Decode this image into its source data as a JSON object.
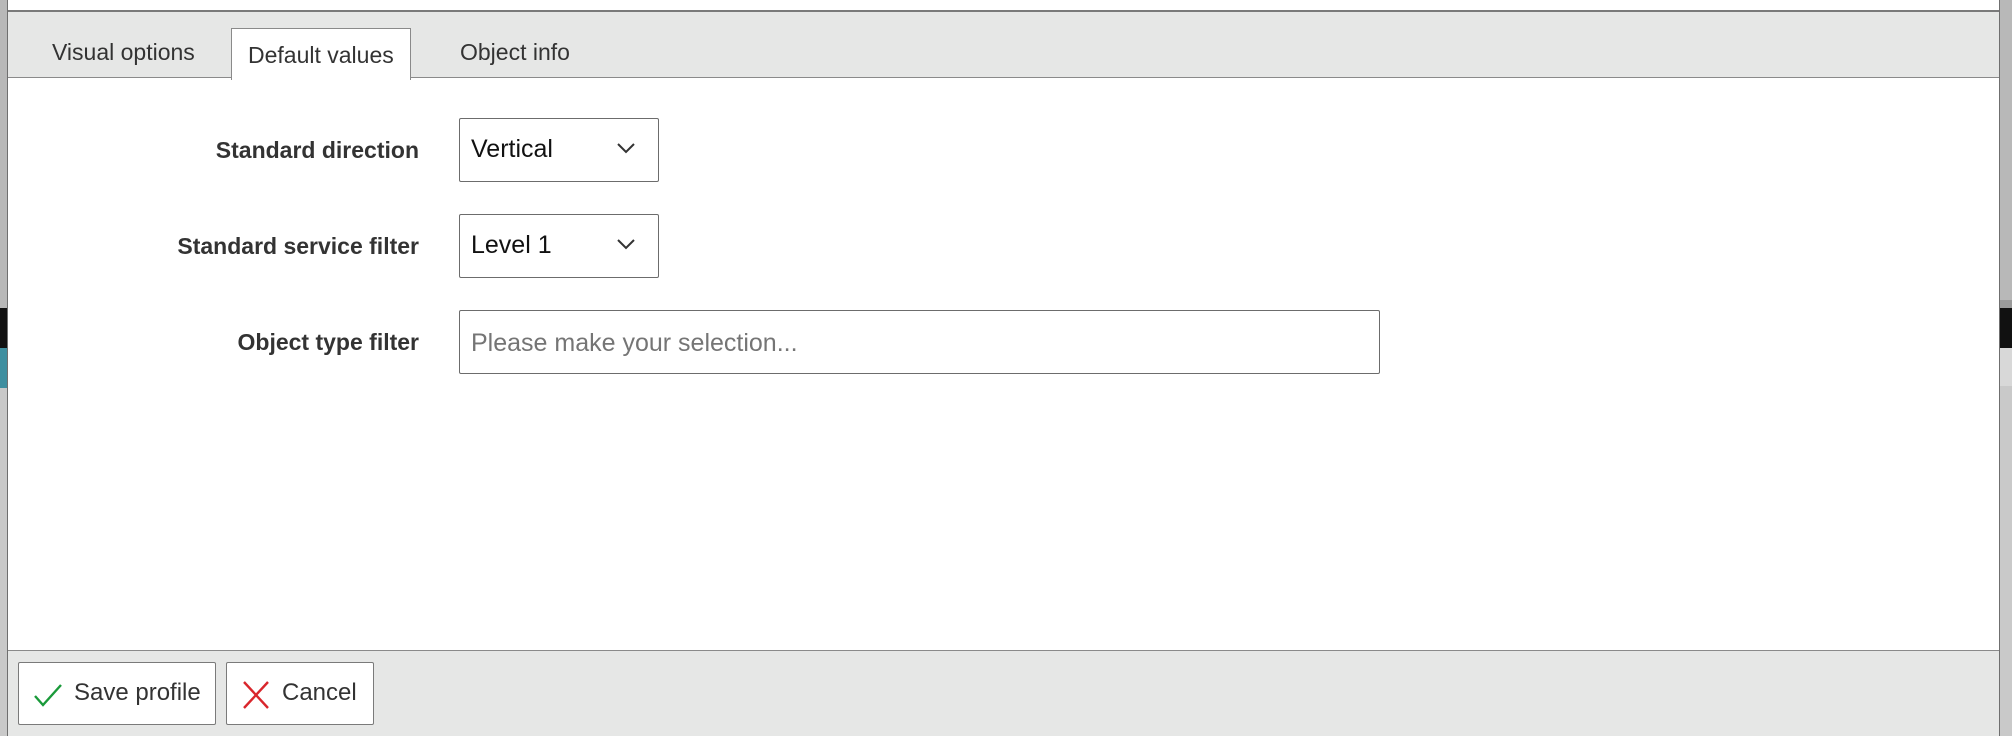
{
  "tabs": {
    "visual_options": "Visual options",
    "default_values": "Default values",
    "object_info": "Object info",
    "active": "default_values"
  },
  "form": {
    "standard_direction": {
      "label": "Standard direction",
      "value": "Vertical"
    },
    "standard_service_filter": {
      "label": "Standard service filter",
      "value": "Level 1"
    },
    "object_type_filter": {
      "label": "Object type filter",
      "placeholder": "Please make your selection..."
    }
  },
  "footer": {
    "save_label": "Save profile",
    "cancel_label": "Cancel",
    "save_icon": "check-icon",
    "cancel_icon": "close-icon",
    "save_icon_color": "#1a9a3a",
    "cancel_icon_color": "#d9262c"
  }
}
